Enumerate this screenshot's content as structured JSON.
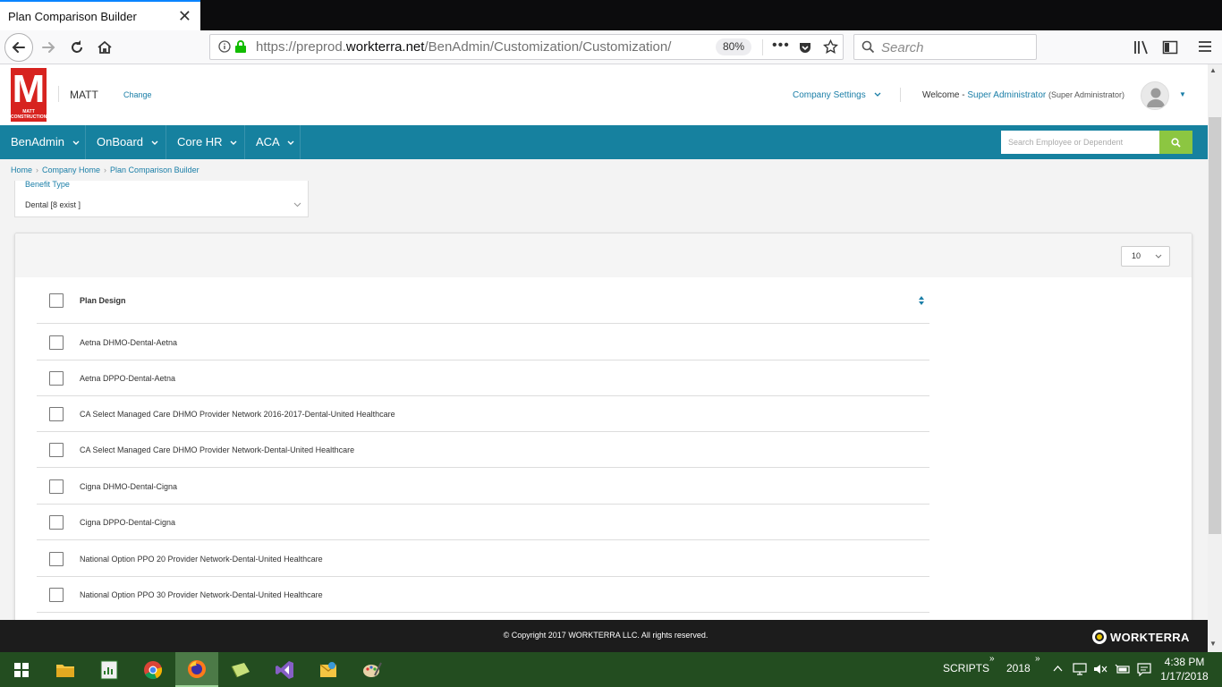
{
  "browser": {
    "tab_title": "Plan Comparison Builder",
    "url_prefix": "https://preprod.",
    "url_host": "workterra.net",
    "url_path": "/BenAdmin/Customization/Customization/",
    "zoom": "80%",
    "search_placeholder": "Search"
  },
  "header": {
    "logo_letter": "M",
    "logo_subtext": "MATT CONSTRUCTION",
    "company_name": "MATT",
    "change_label": "Change",
    "company_settings_label": "Company Settings",
    "welcome_prefix": "Welcome - ",
    "user_name": "Super Administrator",
    "user_role": "(Super Administrator)"
  },
  "nav": {
    "items": [
      {
        "label": "BenAdmin"
      },
      {
        "label": "OnBoard"
      },
      {
        "label": "Core HR"
      },
      {
        "label": "ACA"
      }
    ],
    "search_placeholder": "Search Employee or Dependent"
  },
  "breadcrumb": [
    "Home",
    "Company Home",
    "Plan Comparison Builder"
  ],
  "filter": {
    "label": "Benefit Type",
    "value": "Dental [8 exist ]"
  },
  "grid": {
    "page_size": "10",
    "column_header": "Plan Design",
    "rows": [
      "Aetna DHMO-Dental-Aetna",
      "Aetna DPPO-Dental-Aetna",
      "CA Select Managed Care DHMO Provider Network 2016-2017-Dental-United Healthcare",
      "CA Select Managed Care DHMO Provider Network-Dental-United Healthcare",
      "Cigna DHMO-Dental-Cigna",
      "Cigna DPPO-Dental-Cigna",
      "National Option PPO 20 Provider Network-Dental-United Healthcare",
      "National Option PPO 30 Provider Network-Dental-United Healthcare"
    ]
  },
  "footer": {
    "copyright": "© Copyright 2017 WORKTERRA LLC. All rights reserved.",
    "brand": "WORKTERRA"
  },
  "taskbar": {
    "scripts_label": "SCRIPTS",
    "year_label": "2018",
    "time": "4:38 PM",
    "date": "1/17/2018"
  },
  "colors": {
    "nav_bg": "#16819f",
    "link": "#1a7ea7",
    "search_button": "#8cc641",
    "logo_red": "#d7231f",
    "taskbar": "#234d20"
  }
}
